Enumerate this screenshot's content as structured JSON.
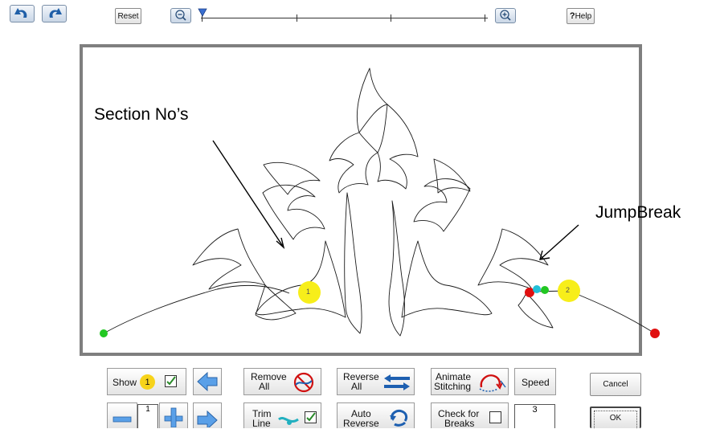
{
  "toolbar": {
    "undo_icon": "undo-arrow-icon",
    "redo_icon": "redo-arrow-icon",
    "reset_label": "Reset",
    "zoom_out_icon": "zoom-out-magnifier-icon",
    "zoom_in_icon": "zoom-in-magnifier-icon",
    "zoom_level": 0.0,
    "help_label": "Help",
    "help_glyph": "?"
  },
  "canvas": {
    "annotations": {
      "section_label": "Section No’s",
      "jump_label": "JumpBreak"
    },
    "section_markers": [
      "1",
      "2"
    ],
    "colors": {
      "start_dot": "#22c722",
      "end_dot": "#e01010",
      "section_marker": "#f7ee1a",
      "jump_dot": "#22c0d8"
    }
  },
  "controls": {
    "show_label": "Show",
    "show_badge": "1",
    "remove_all_label_1": "Remove",
    "remove_all_label_2": "All",
    "reverse_all_label_1": "Reverse",
    "reverse_all_label_2": "All",
    "animate_label_1": "Animate",
    "animate_label_2": "Stitching",
    "speed_label": "Speed",
    "cancel_label": "Cancel",
    "section_number": "1",
    "trim_label_1": "Trim",
    "trim_label_2": "Line",
    "auto_reverse_label_1": "Auto",
    "auto_reverse_label_2": "Reverse",
    "check_breaks_label_1": "Check for",
    "check_breaks_label_2": "Breaks",
    "speed_value": "3",
    "ok_label": "OK"
  }
}
